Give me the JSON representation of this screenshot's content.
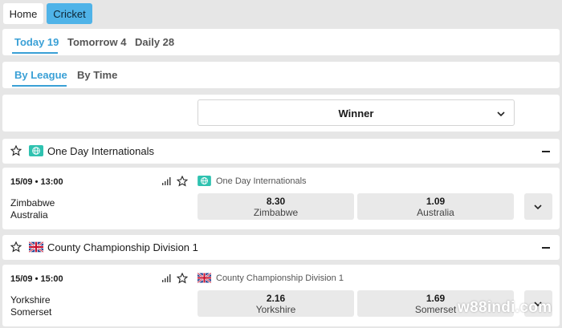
{
  "nav": {
    "home_label": "Home",
    "cricket_label": "Cricket"
  },
  "day_tabs": [
    {
      "label": "Today 19"
    },
    {
      "label": "Tomorrow 4"
    },
    {
      "label": "Daily 28"
    }
  ],
  "view_tabs": [
    {
      "label": "By League"
    },
    {
      "label": "By Time"
    }
  ],
  "market_select": {
    "value": "Winner"
  },
  "leagues": [
    {
      "title": "One Day Internationals",
      "icon": "globe-icon",
      "match": {
        "time": "15/09 • 13:00",
        "home": "Zimbabwe",
        "away": "Australia",
        "league_label": "One Day Internationals",
        "odds": [
          {
            "value": "8.30",
            "name": "Zimbabwe"
          },
          {
            "value": "1.09",
            "name": "Australia"
          }
        ]
      }
    },
    {
      "title": "County Championship Division 1",
      "icon": "uk-flag-icon",
      "match": {
        "time": "15/09 • 15:00",
        "home": "Yorkshire",
        "away": "Somerset",
        "league_label": "County Championship Division 1",
        "odds": [
          {
            "value": "2.16",
            "name": "Yorkshire"
          },
          {
            "value": "1.69",
            "name": "Somerset"
          }
        ]
      }
    }
  ],
  "watermark": "w88indi.com",
  "colors": {
    "accent": "#3aa0d6",
    "cricket_button": "#4fb3e8",
    "globe_badge": "#2fc2b0"
  }
}
